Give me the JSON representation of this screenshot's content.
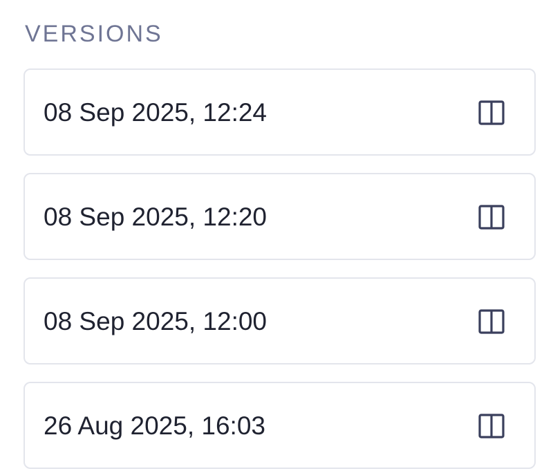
{
  "versions_panel": {
    "title": "VERSIONS",
    "items": [
      {
        "label": "08 Sep 2025, 12:24",
        "icon": "columns-icon"
      },
      {
        "label": "08 Sep 2025, 12:20",
        "icon": "columns-icon"
      },
      {
        "label": "08 Sep 2025, 12:00",
        "icon": "columns-icon"
      },
      {
        "label": "26 Aug 2025, 16:03",
        "icon": "columns-icon"
      }
    ]
  },
  "colors": {
    "title": "#6f7594",
    "text": "#1f2230",
    "border": "#e3e5ec",
    "icon": "#3a3f5c"
  }
}
